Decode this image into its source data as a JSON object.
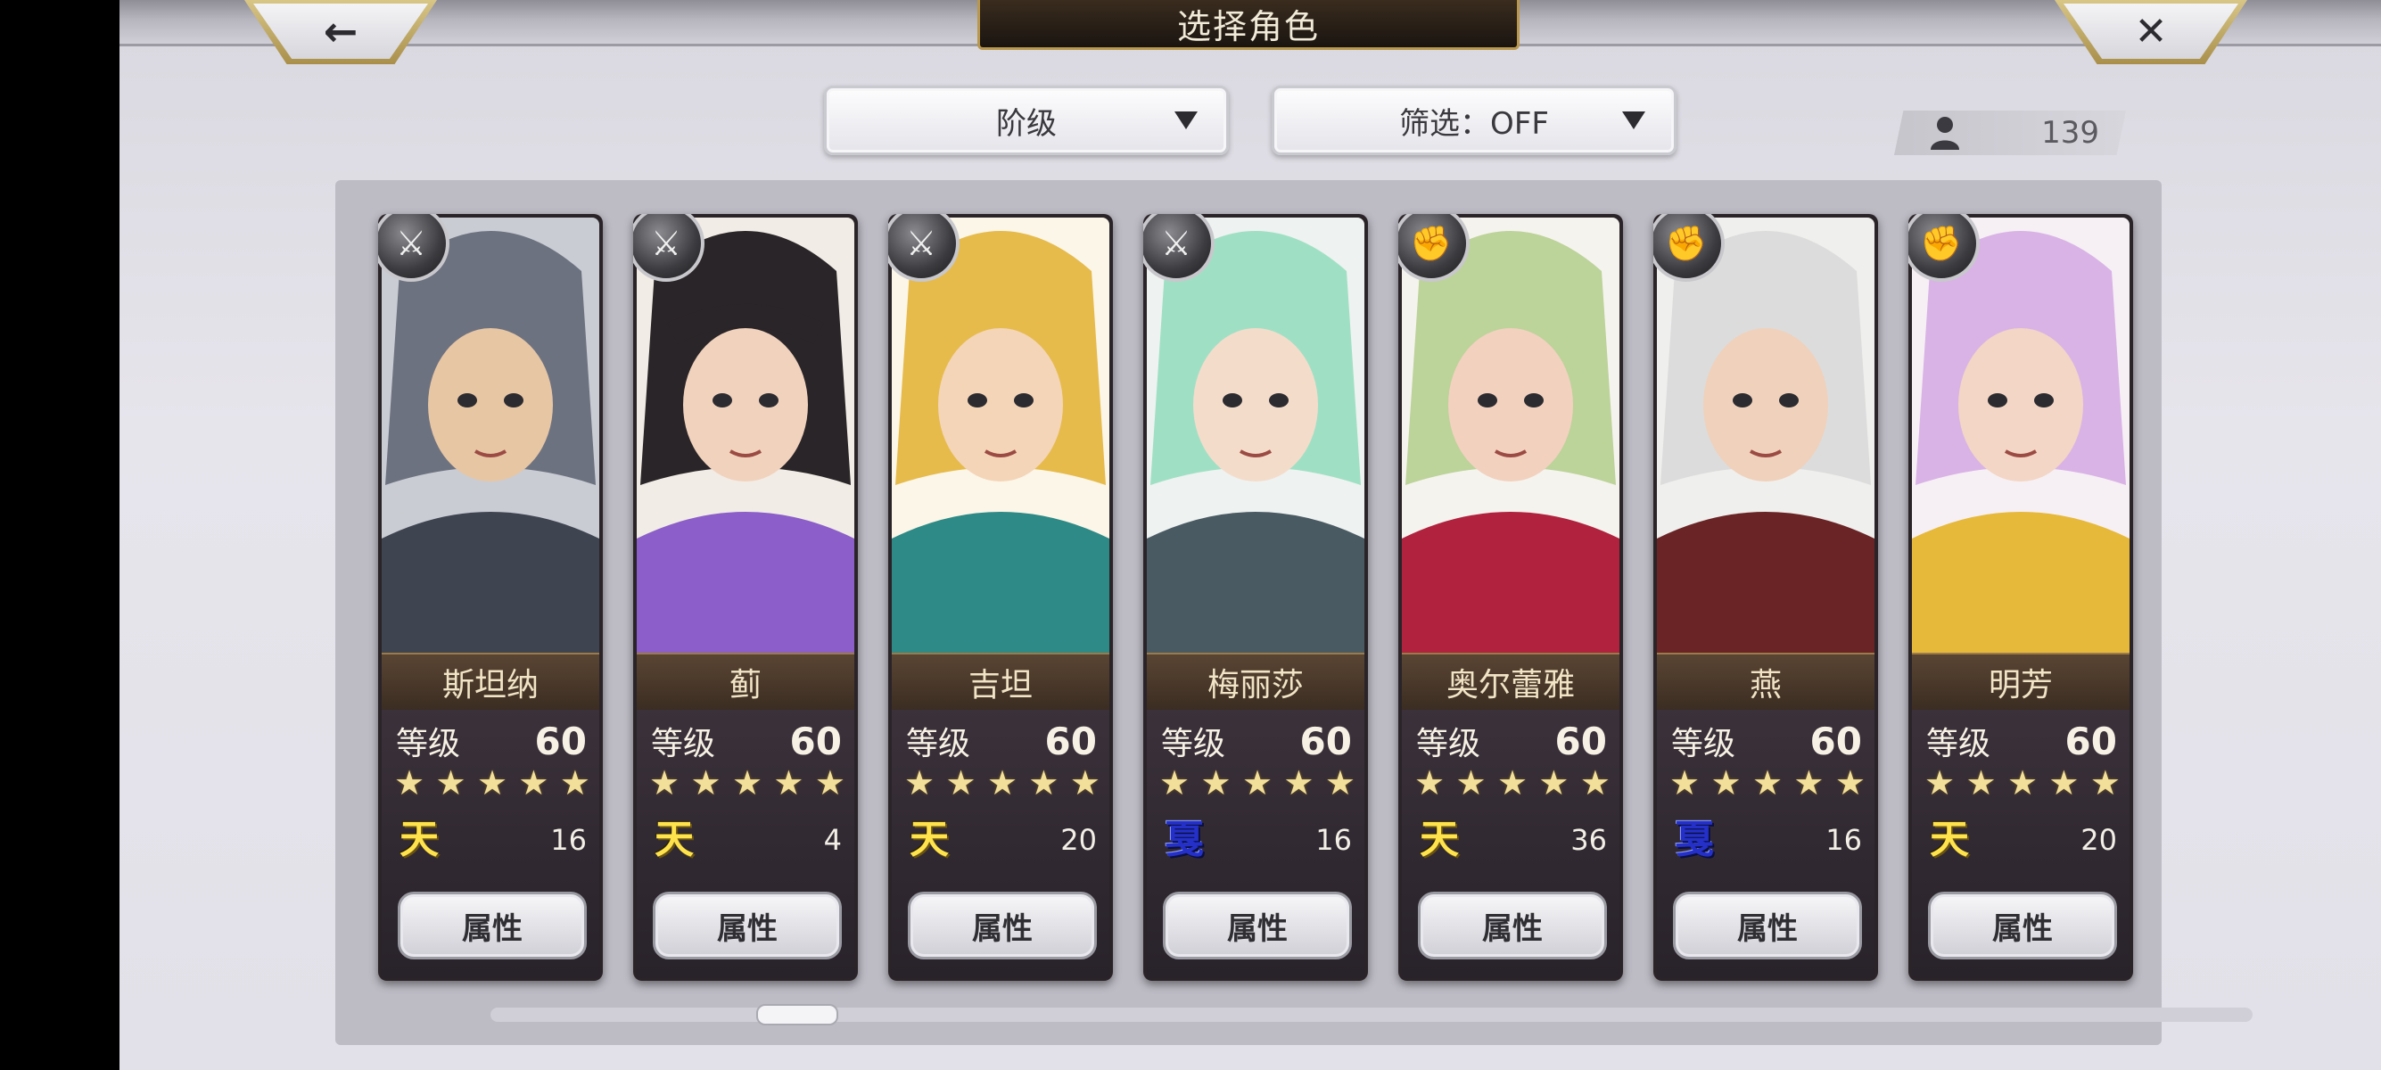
{
  "header": {
    "title": "选择角色",
    "back_icon": "←",
    "close_icon": "✕"
  },
  "controls": {
    "sort_label": "阶级",
    "filter_label": "筛选：OFF"
  },
  "roster_count": "139",
  "attr_button_label": "属性",
  "level_label": "等级",
  "star_glyph": "★",
  "characters": [
    {
      "name": "斯坦纳",
      "level": "60",
      "rank": "天",
      "rank_color": "gold",
      "count": "16",
      "class_icon": "sword-icon"
    },
    {
      "name": "蓟",
      "level": "60",
      "rank": "天",
      "rank_color": "gold",
      "count": "4",
      "class_icon": "sword-icon"
    },
    {
      "name": "吉坦",
      "level": "60",
      "rank": "天",
      "rank_color": "gold",
      "count": "20",
      "class_icon": "sword-icon"
    },
    {
      "name": "梅丽莎",
      "level": "60",
      "rank": "戛",
      "rank_color": "blue",
      "count": "16",
      "class_icon": "sword-icon"
    },
    {
      "name": "奥尔蕾雅",
      "level": "60",
      "rank": "天",
      "rank_color": "gold",
      "count": "36",
      "class_icon": "fist-icon"
    },
    {
      "name": "燕",
      "level": "60",
      "rank": "戛",
      "rank_color": "blue",
      "count": "16",
      "class_icon": "fist-icon"
    },
    {
      "name": "明芳",
      "level": "60",
      "rank": "天",
      "rank_color": "gold",
      "count": "20",
      "class_icon": "fist-icon"
    }
  ],
  "colors": {
    "rank_gold": "#ffe34d",
    "rank_blue": "#2430c8",
    "card_frame": "#2a2428",
    "name_bar": "#5a4533"
  }
}
